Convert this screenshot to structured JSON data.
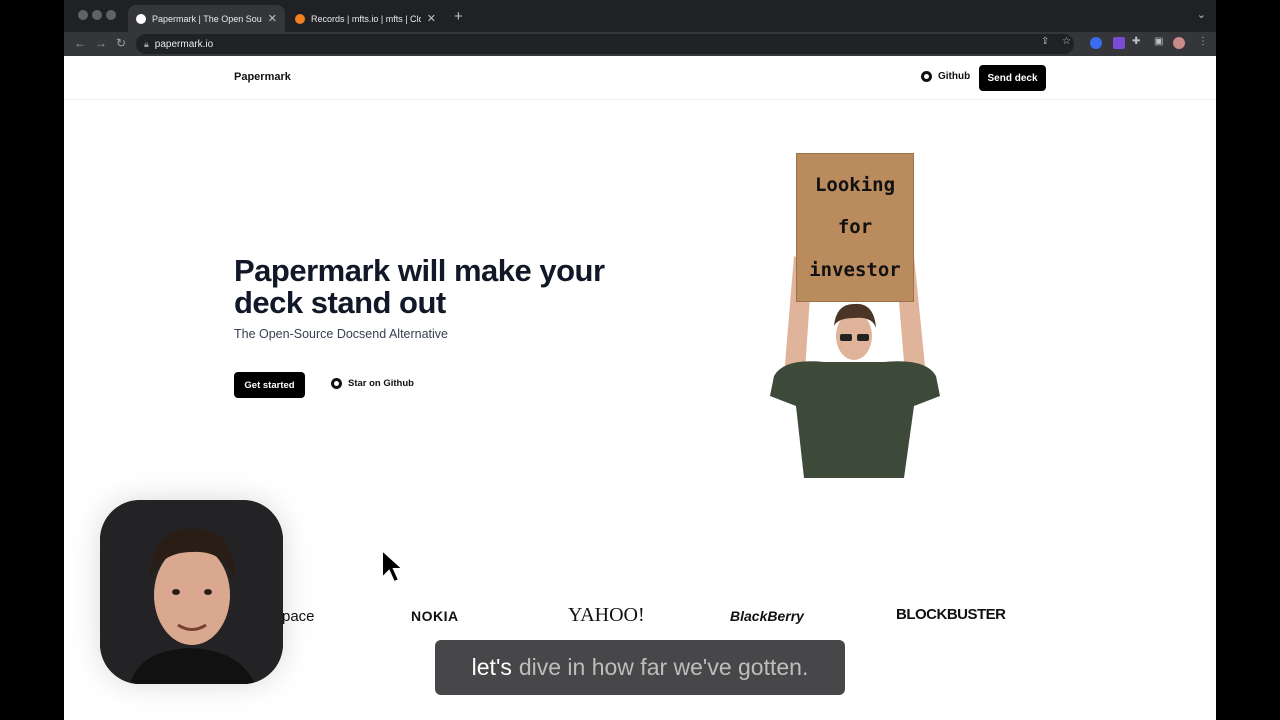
{
  "browser": {
    "tabs": [
      {
        "title": "Papermark | The Open Source",
        "active": true
      },
      {
        "title": "Records | mfts.io | mfts | Cloudf",
        "active": false
      }
    ],
    "new_tab": "+",
    "close": "✕",
    "url": "papermark.io",
    "icons": [
      "back-icon",
      "forward-icon",
      "reload-icon",
      "lock-icon",
      "share-icon",
      "star-icon",
      "extensions-icon",
      "sidebar-icon",
      "profile-icon",
      "menu-icon"
    ]
  },
  "site": {
    "brand": "Papermark",
    "nav": {
      "github": "Github",
      "send_deck": "Send deck"
    },
    "hero": {
      "title": "Papermark will make your deck stand out",
      "subtitle": "The Open-Source Docsend Alternative",
      "primary_cta": "Get started",
      "secondary_cta": "Star on Github"
    },
    "sign": {
      "line1": "Looking",
      "line2": "for",
      "line3": "investor"
    },
    "logos": [
      "pace",
      "NOKIA",
      "YAHOO!",
      "BlackBerry",
      "BLOCKBUSTER"
    ]
  },
  "overlay": {
    "caption_lead": "let's",
    "caption_rest": "dive in how far we've gotten."
  },
  "colors": {
    "chrome_dark": "#202124",
    "chrome_mid": "#35363a",
    "button": "#000000",
    "text": "#111827"
  }
}
